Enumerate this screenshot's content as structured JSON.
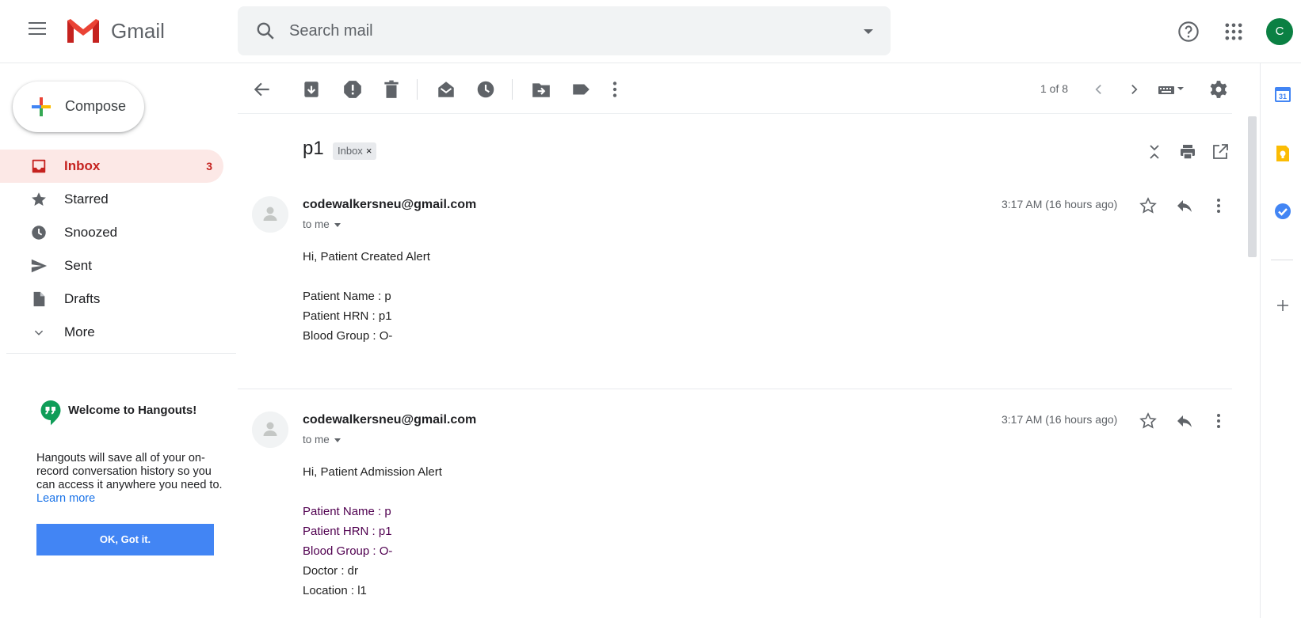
{
  "header": {
    "app_name": "Gmail",
    "search_placeholder": "Search mail",
    "avatar_letter": "C"
  },
  "nav": {
    "compose_label": "Compose",
    "items": [
      {
        "label": "Inbox",
        "count": "3",
        "icon": "inbox-icon"
      },
      {
        "label": "Starred",
        "count": "",
        "icon": "star-icon"
      },
      {
        "label": "Snoozed",
        "count": "",
        "icon": "clock-icon"
      },
      {
        "label": "Sent",
        "count": "",
        "icon": "send-icon"
      },
      {
        "label": "Drafts",
        "count": "",
        "icon": "draft-icon"
      },
      {
        "label": "More",
        "count": "",
        "icon": "chevron-down-icon"
      }
    ]
  },
  "hangouts": {
    "title": "Welcome to Hangouts!",
    "body": "Hangouts will save all of your on-record conversation history so you can access it anywhere you need to.",
    "link": "Learn more",
    "button": "OK, Got it."
  },
  "toolbar": {
    "pager": "1 of 8"
  },
  "thread": {
    "subject": "p1",
    "label_chip": "Inbox",
    "label_chip_close": "×",
    "messages": [
      {
        "sender": "codewalkersneu@gmail.com",
        "recipient": "to me",
        "time": "3:17 AM (16 hours ago)",
        "greeting": "Hi, Patient Created Alert",
        "lines": [
          "Patient Name : p",
          "Patient HRN : p1",
          "Blood Group : O-"
        ]
      },
      {
        "sender": "codewalkersneu@gmail.com",
        "recipient": "to me",
        "time": "3:17 AM (16 hours ago)",
        "greeting": "Hi, Patient Admission Alert",
        "lines": [
          "Patient Name : p",
          "Patient HRN : p1",
          "Blood Group : O-",
          "Doctor : dr",
          "Location : l1"
        ]
      }
    ]
  },
  "side_panel": {
    "calendar_day": "31"
  },
  "colors": {
    "accent": "#4285f4",
    "inbox_active_bg": "#fce8e6",
    "inbox_active_text": "#c5221f",
    "quoted_text": "#500050",
    "avatar_bg": "#0b8043"
  }
}
